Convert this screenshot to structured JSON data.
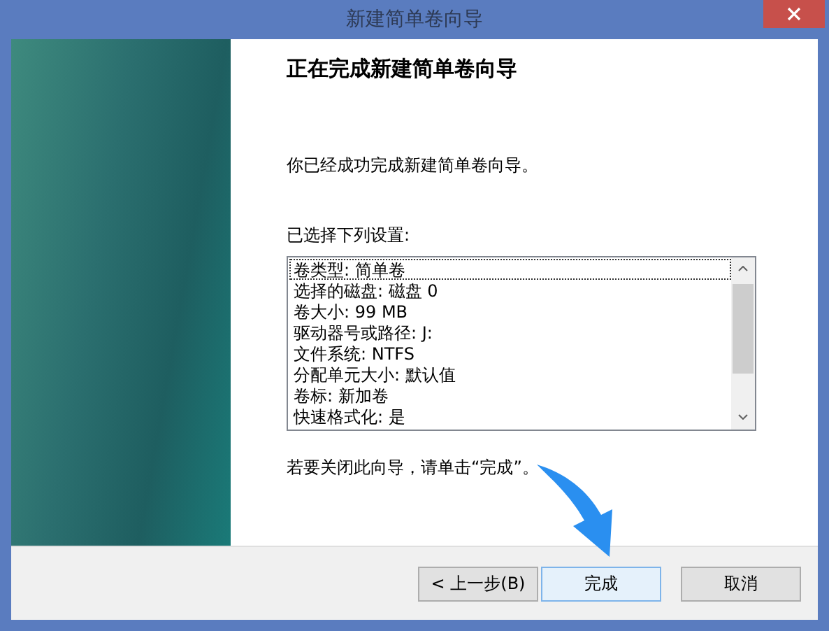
{
  "window": {
    "title": "新建简单卷向导"
  },
  "heading": "正在完成新建简单卷向导",
  "message": "你已经成功完成新建简单卷向导。",
  "settings_label": "已选择下列设置:",
  "settings": [
    {
      "text": "卷类型: 简单卷",
      "selected": true
    },
    {
      "text": "选择的磁盘: 磁盘 0",
      "selected": false
    },
    {
      "text": "卷大小: 99 MB",
      "selected": false
    },
    {
      "text": "驱动器号或路径: J:",
      "selected": false
    },
    {
      "text": "文件系统: NTFS",
      "selected": false
    },
    {
      "text": "分配单元大小: 默认值",
      "selected": false
    },
    {
      "text": "卷标: 新加卷",
      "selected": false
    },
    {
      "text": "快速格式化: 是",
      "selected": false
    }
  ],
  "hint": "若要关闭此向导，请单击“完成”。",
  "buttons": [
    {
      "label": "< 上一步(B)",
      "default": false
    },
    {
      "label": "完成",
      "default": true
    },
    {
      "label": "取消",
      "default": false
    }
  ]
}
